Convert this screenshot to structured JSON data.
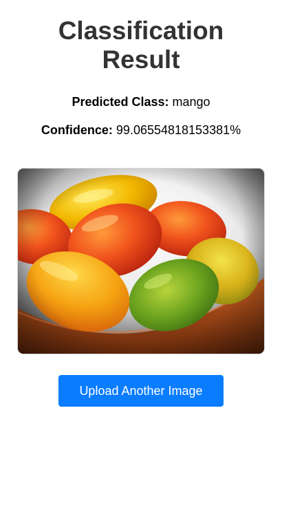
{
  "page": {
    "title_line1": "Classification",
    "title_line2": "Result"
  },
  "result": {
    "predicted_label": "Predicted Class:",
    "predicted_value": "mango",
    "confidence_label": "Confidence:",
    "confidence_value": "99.06554818153381%"
  },
  "image": {
    "subject": "bowl-of-mangoes-photo"
  },
  "actions": {
    "upload_label": "Upload Another Image"
  },
  "colors": {
    "title": "#333333",
    "button_bg": "#0a7cff",
    "button_text": "#ffffff"
  }
}
